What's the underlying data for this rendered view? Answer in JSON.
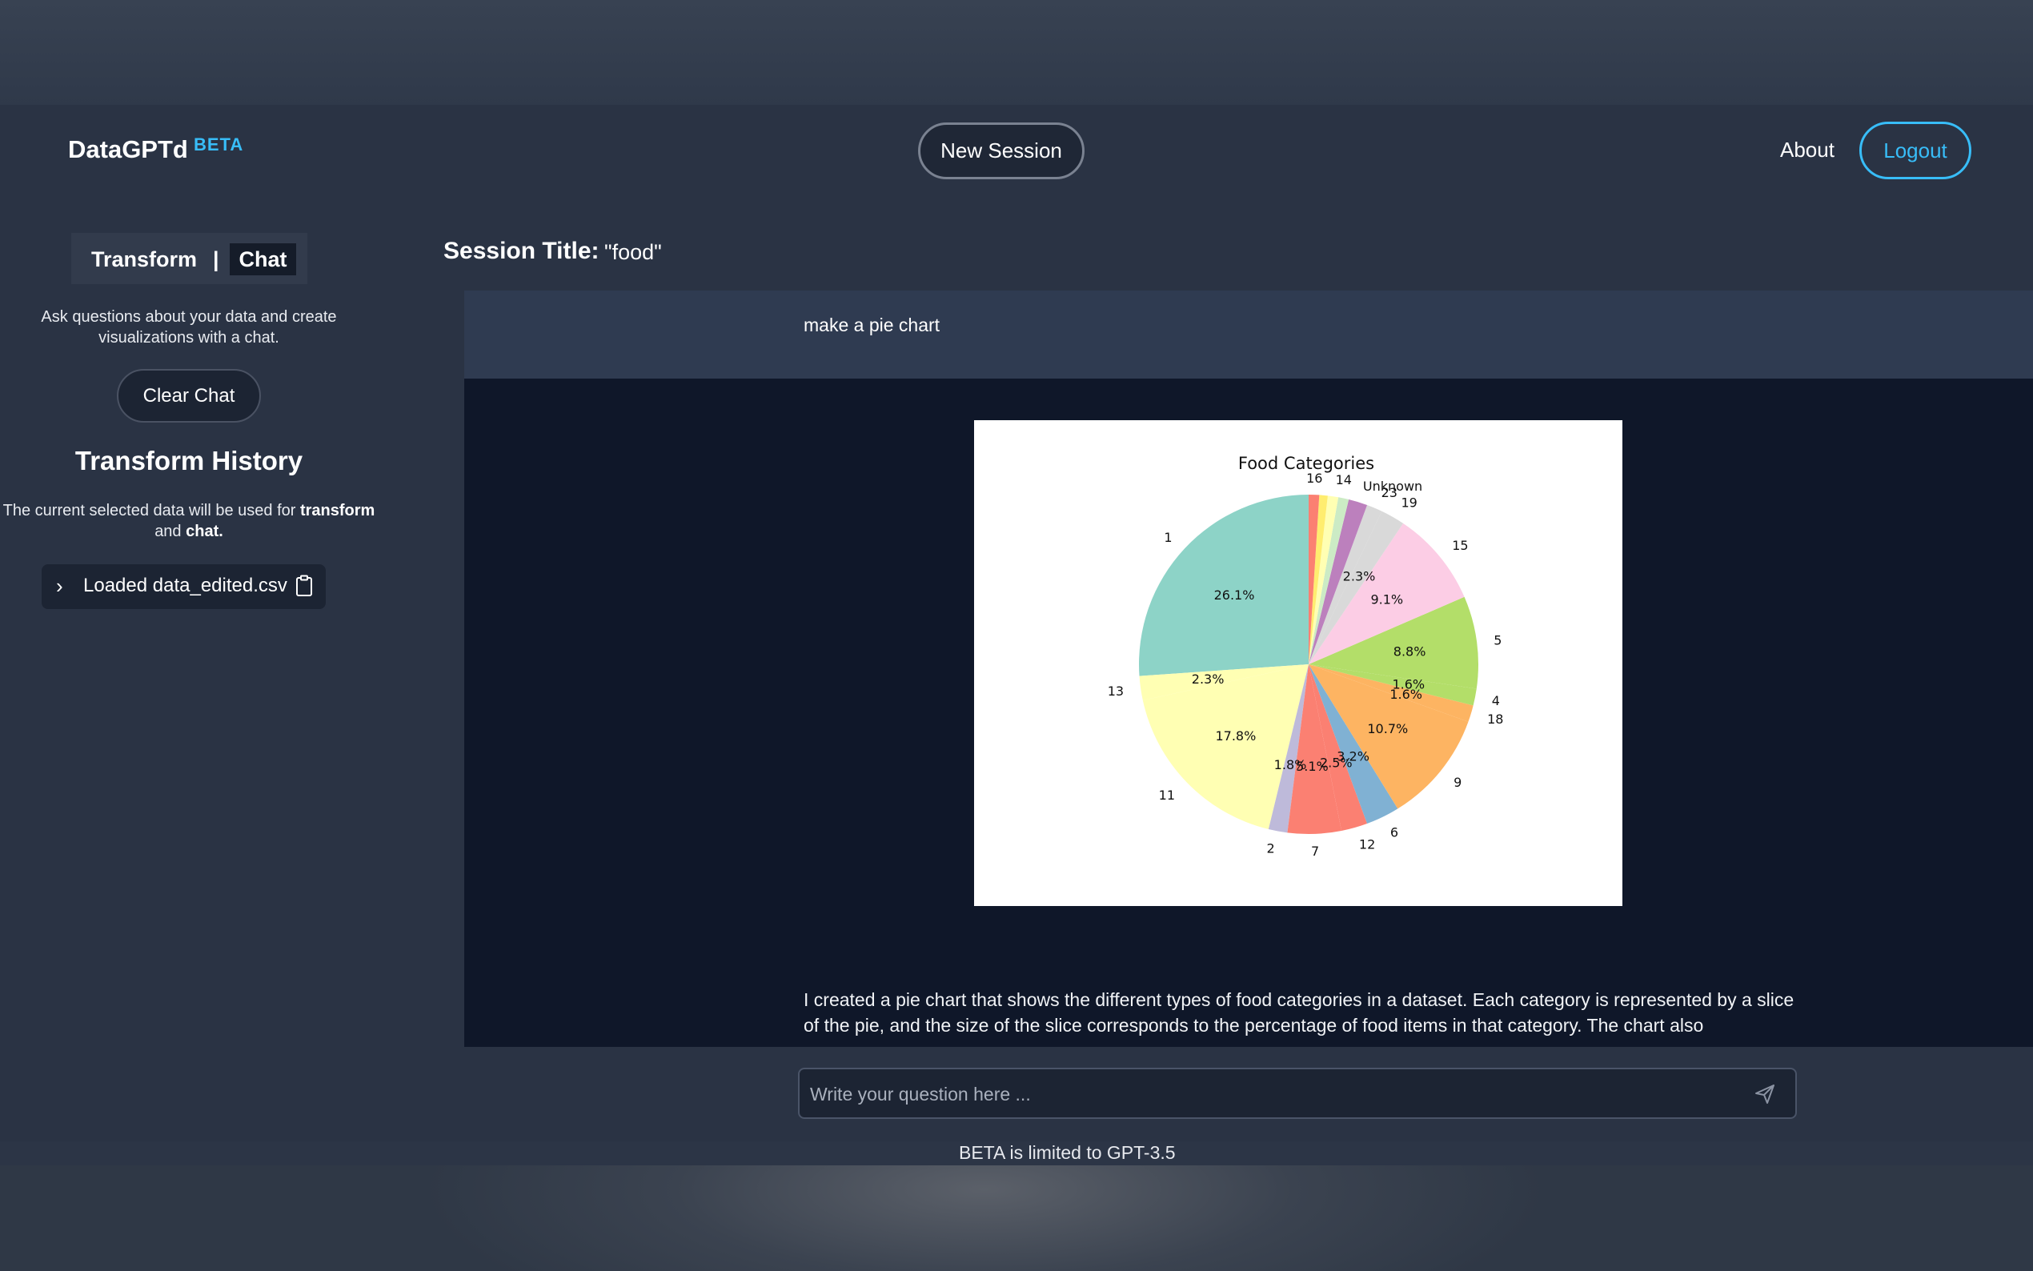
{
  "header": {
    "brand": "DataGPTd",
    "brand_badge": "BETA",
    "new_session_label": "New Session",
    "about_label": "About",
    "logout_label": "Logout"
  },
  "sidebar": {
    "mode_transform": "Transform",
    "mode_separator": "|",
    "mode_chat": "Chat",
    "mode_description": "Ask questions about your data and create visualizations with a chat.",
    "clear_chat_label": "Clear Chat",
    "history_title": "Transform History",
    "history_desc_prefix": "The current selected data will be used for ",
    "history_desc_transform": "transform",
    "history_desc_and": " and ",
    "history_desc_chat": "chat.",
    "loaded_item_label": "Loaded data_edited.csv"
  },
  "main": {
    "session_title_label": "Session Title:",
    "session_title_value": "\"food\"",
    "user_message": "make a pie chart",
    "assistant_message": "I created a pie chart that shows the different types of food categories in a dataset. Each category is represented by a slice of the pie, and the size of the slice corresponds to the percentage of food items in that category. The chart also"
  },
  "composer": {
    "placeholder": "Write your question here ..."
  },
  "footer": {
    "note": "BETA is limited to GPT-3.5"
  },
  "colors": {
    "accent": "#38bdf8",
    "background": "#2a3344",
    "chat_background": "#0f1729"
  },
  "icons": {
    "loaded_chevron": "chevron-right-icon",
    "loaded_copy": "clipboard-icon",
    "send": "send-icon"
  },
  "chart_data": {
    "type": "pie",
    "title": "Food Categories",
    "slices": [
      {
        "label": "1",
        "value": 26.1,
        "pct_label": "26.1%",
        "color": "#8dd3c7"
      },
      {
        "label": "13",
        "value": 2.3,
        "pct_label": "2.3%",
        "color": "#ffffb3"
      },
      {
        "label": "11",
        "value": 17.8,
        "pct_label": "17.8%",
        "color": "#ffffb3"
      },
      {
        "label": "2",
        "value": 1.8,
        "pct_label": "1.8%",
        "color": "#bebada"
      },
      {
        "label": "7",
        "value": 5.1,
        "pct_label": "5.1%",
        "color": "#fb8072"
      },
      {
        "label": "12",
        "value": 2.5,
        "pct_label": "2.5%",
        "color": "#fb8072"
      },
      {
        "label": "6",
        "value": 3.2,
        "pct_label": "3.2%",
        "color": "#80b1d3"
      },
      {
        "label": "9",
        "value": 10.7,
        "pct_label": "10.7%",
        "color": "#fdb462"
      },
      {
        "label": "18",
        "value": 1.6,
        "pct_label": "1.6%",
        "color": "#fdb462"
      },
      {
        "label": "4",
        "value": 1.6,
        "pct_label": "1.6%",
        "color": "#b3de69"
      },
      {
        "label": "5",
        "value": 8.8,
        "pct_label": "8.8%",
        "color": "#b3de69"
      },
      {
        "label": "15",
        "value": 9.1,
        "pct_label": "9.1%",
        "color": "#fccde5"
      },
      {
        "label": "19",
        "value": 2.3,
        "pct_label": "2.3%",
        "color": "#d9d9d9"
      },
      {
        "label": "23",
        "value": 1.5,
        "pct_label": "",
        "color": "#d9d9d9"
      },
      {
        "label": "Unknown",
        "value": 1.8,
        "pct_label": "",
        "color": "#bc80bd"
      },
      {
        "label": "",
        "value": 1.0,
        "pct_label": "",
        "color": "#ccebc5"
      },
      {
        "label": "14",
        "value": 1.0,
        "pct_label": "",
        "color": "#ffffb3"
      },
      {
        "label": "",
        "value": 0.8,
        "pct_label": "",
        "color": "#ffed6f"
      },
      {
        "label": "16",
        "value": 1.0,
        "pct_label": "",
        "color": "#fb8072"
      }
    ]
  }
}
